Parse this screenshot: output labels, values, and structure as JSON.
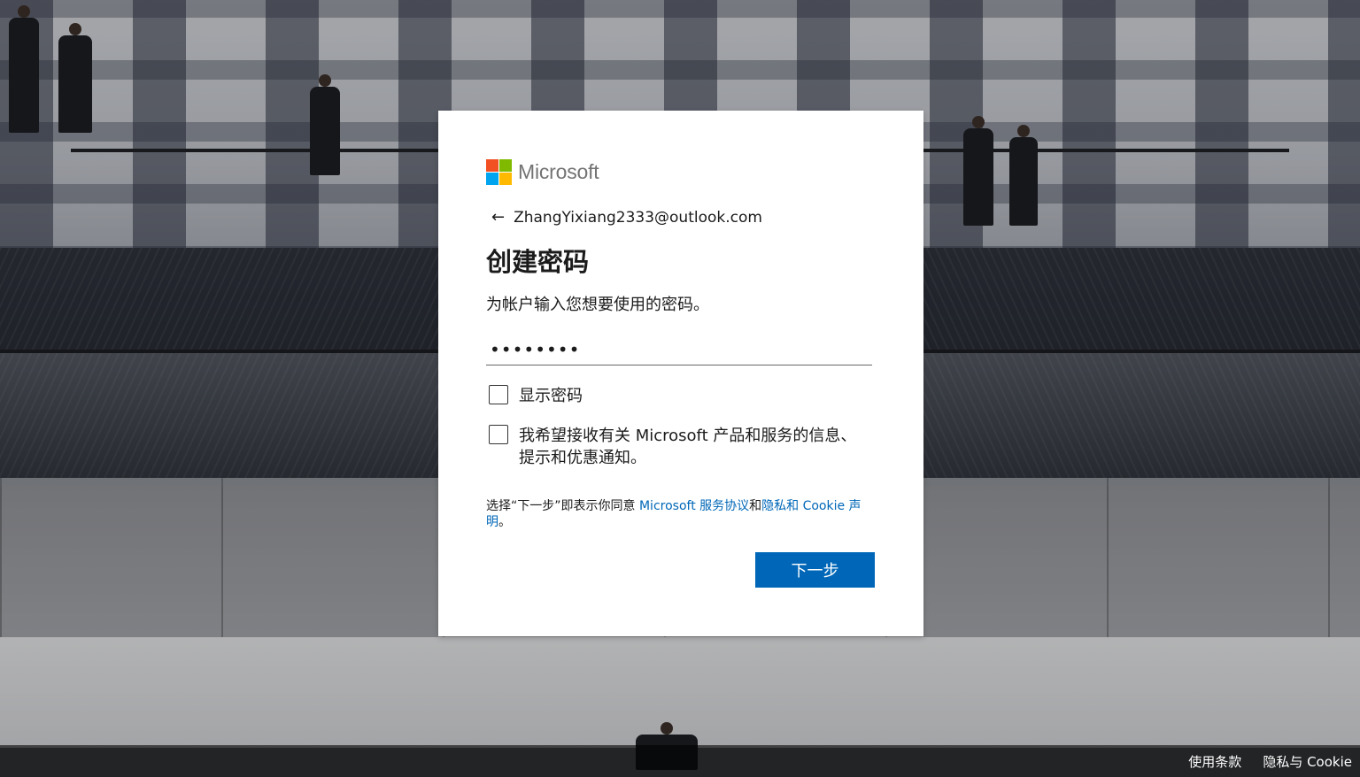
{
  "brand": {
    "name": "Microsoft",
    "colors": {
      "red": "#f25022",
      "green": "#7fba00",
      "blue": "#00a4ef",
      "yellow": "#ffb900"
    }
  },
  "identity": {
    "back_icon": "arrow-left-icon",
    "email": "ZhangYixiang2333@outlook.com"
  },
  "page": {
    "title": "创建密码",
    "subtitle": "为帐户输入您想要使用的密码。"
  },
  "password_field": {
    "value": "••••••••"
  },
  "options": {
    "show_password": {
      "label": "显示密码",
      "checked": false
    },
    "marketing": {
      "label": "我希望接收有关 Microsoft 产品和服务的信息、提示和优惠通知。",
      "checked": false
    }
  },
  "legal": {
    "prefix": "选择“下一步”即表示你同意 ",
    "services_link": "Microsoft 服务协议",
    "and": "和",
    "privacy_link": "隐私和 Cookie 声明",
    "suffix": "。"
  },
  "actions": {
    "next_label": "下一步",
    "accent_color": "#0067b8"
  },
  "footer": {
    "terms": "使用条款",
    "privacy": "隐私与 Cookie"
  }
}
